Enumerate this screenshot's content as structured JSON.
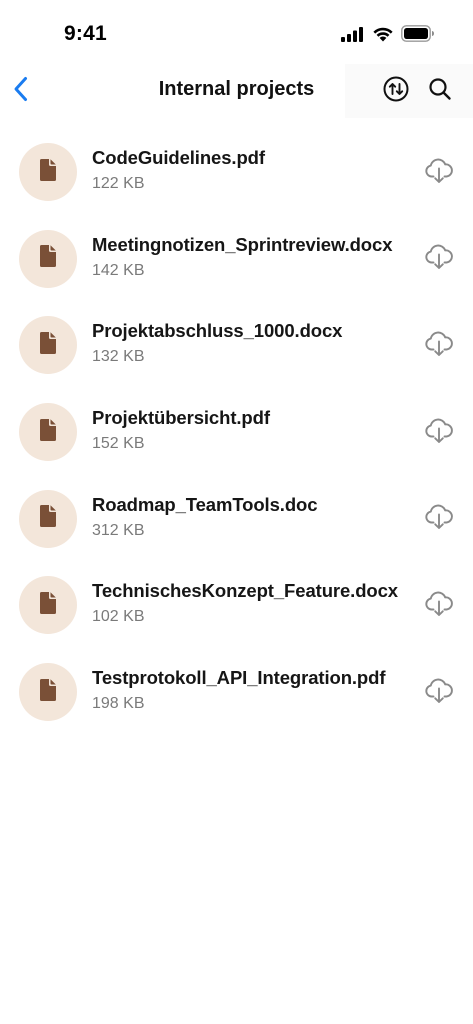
{
  "status_bar": {
    "time": "9:41"
  },
  "header": {
    "title": "Internal projects",
    "back_icon": "chevron-left-icon",
    "sort_icon": "sort-arrows-icon",
    "search_icon": "search-icon"
  },
  "colors": {
    "accent": "#1a7cf0",
    "avatar_bg": "#f3e6da",
    "file_icon": "#7a5037",
    "download_icon": "#8a8a8a"
  },
  "files": [
    {
      "name": "CodeGuidelines.pdf",
      "size": "122 KB"
    },
    {
      "name": "Meetingnotizen_Sprintreview.docx",
      "size": "142 KB"
    },
    {
      "name": "Projektabschluss_1000.docx",
      "size": "132 KB"
    },
    {
      "name": "Projektübersicht.pdf",
      "size": "152 KB"
    },
    {
      "name": "Roadmap_TeamTools.doc",
      "size": "312 KB"
    },
    {
      "name": "TechnischesKonzept_Feature.docx",
      "size": "102 KB"
    },
    {
      "name": "Testprotokoll_API_Integration.pdf",
      "size": "198 KB"
    }
  ]
}
